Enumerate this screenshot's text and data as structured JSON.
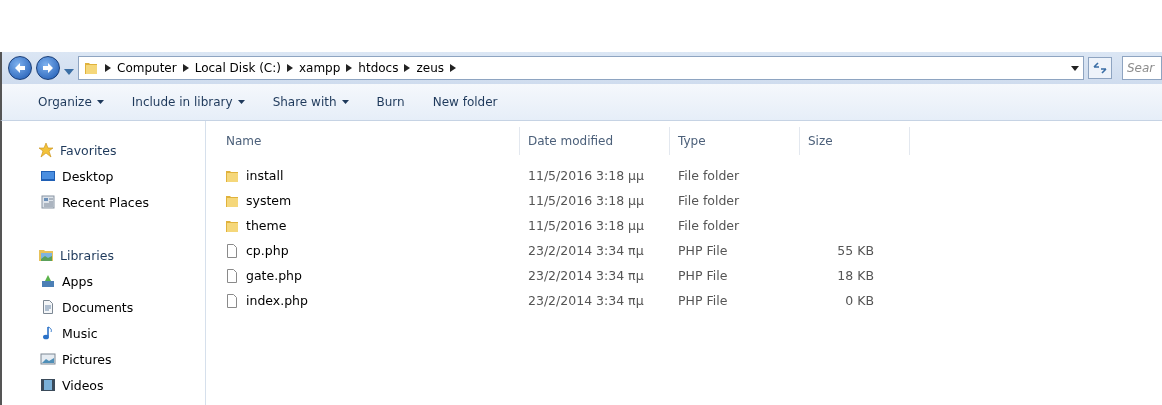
{
  "address_bar": {
    "crumbs": [
      "Computer",
      "Local Disk (C:)",
      "xampp",
      "htdocs",
      "zeus"
    ]
  },
  "search": {
    "placeholder": "Sear"
  },
  "toolbar": [
    {
      "label": "Organize",
      "dropdown": true
    },
    {
      "label": "Include in library",
      "dropdown": true
    },
    {
      "label": "Share with",
      "dropdown": true
    },
    {
      "label": "Burn",
      "dropdown": false
    },
    {
      "label": "New folder",
      "dropdown": false
    }
  ],
  "sidebar": {
    "groups": [
      {
        "label": "Favorites",
        "kind": "star",
        "children": [
          {
            "label": "Desktop",
            "kind": "desktop"
          },
          {
            "label": "Recent Places",
            "kind": "recent"
          }
        ]
      },
      {
        "label": "Libraries",
        "kind": "library",
        "children": [
          {
            "label": "Apps",
            "kind": "apps"
          },
          {
            "label": "Documents",
            "kind": "documents"
          },
          {
            "label": "Music",
            "kind": "music"
          },
          {
            "label": "Pictures",
            "kind": "pictures"
          },
          {
            "label": "Videos",
            "kind": "videos"
          }
        ]
      }
    ]
  },
  "table": {
    "columns": [
      "Name",
      "Date modified",
      "Type",
      "Size"
    ],
    "rows": [
      {
        "name": "install",
        "kind": "folder",
        "date": "11/5/2016 3:18 μμ",
        "type": "File folder"
      },
      {
        "name": "system",
        "kind": "folder",
        "date": "11/5/2016 3:18 μμ",
        "type": "File folder"
      },
      {
        "name": "theme",
        "kind": "folder",
        "date": "11/5/2016 3:18 μμ",
        "type": "File folder"
      },
      {
        "name": "cp.php",
        "kind": "file",
        "date": "23/2/2014 3:34 πμ",
        "type": "PHP File",
        "size": "55 KB"
      },
      {
        "name": "gate.php",
        "kind": "file",
        "date": "23/2/2014 3:34 πμ",
        "type": "PHP File",
        "size": "18 KB"
      },
      {
        "name": "index.php",
        "kind": "file",
        "date": "23/2/2014 3:34 πμ",
        "type": "PHP File",
        "size": "0 KB"
      }
    ]
  }
}
